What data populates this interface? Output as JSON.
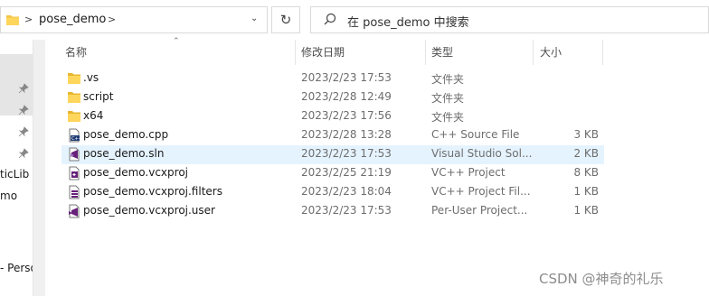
{
  "address_bar": {
    "breadcrumb": [
      "pose_demo"
    ],
    "search_placeholder": "在 pose_demo 中搜索"
  },
  "columns": {
    "name": "名称",
    "date": "修改日期",
    "type": "类型",
    "size": "大小"
  },
  "sidebar": {
    "items": [
      "ticLib",
      "mo",
      "- Perso"
    ]
  },
  "files": [
    {
      "name": ".vs",
      "date": "2023/2/23 17:53",
      "type": "文件夹",
      "size": "",
      "icon": "folder-icon"
    },
    {
      "name": "script",
      "date": "2023/2/28 12:49",
      "type": "文件夹",
      "size": "",
      "icon": "folder-icon"
    },
    {
      "name": "x64",
      "date": "2023/2/23 17:56",
      "type": "文件夹",
      "size": "",
      "icon": "folder-icon"
    },
    {
      "name": "pose_demo.cpp",
      "date": "2023/2/28 13:28",
      "type": "C++ Source File",
      "size": "3 KB",
      "icon": "cpp-file-icon"
    },
    {
      "name": "pose_demo.sln",
      "date": "2023/2/23 17:53",
      "type": "Visual Studio Sol...",
      "size": "2 KB",
      "icon": "visual-studio-solution-icon"
    },
    {
      "name": "pose_demo.vcxproj",
      "date": "2023/2/25 21:19",
      "type": "VC++ Project",
      "size": "8 KB",
      "icon": "vcxproj-file-icon"
    },
    {
      "name": "pose_demo.vcxproj.filters",
      "date": "2023/2/23 18:04",
      "type": "VC++ Project Fil...",
      "size": "1 KB",
      "icon": "filters-file-icon"
    },
    {
      "name": "pose_demo.vcxproj.user",
      "date": "2023/2/23 17:53",
      "type": "Per-User Project...",
      "size": "1 KB",
      "icon": "user-file-icon"
    }
  ],
  "watermark": "CSDN @神奇的礼乐",
  "colors": {
    "folder": "#f5c342",
    "selection": "#e5f3ff",
    "vs_purple": "#68217a"
  }
}
